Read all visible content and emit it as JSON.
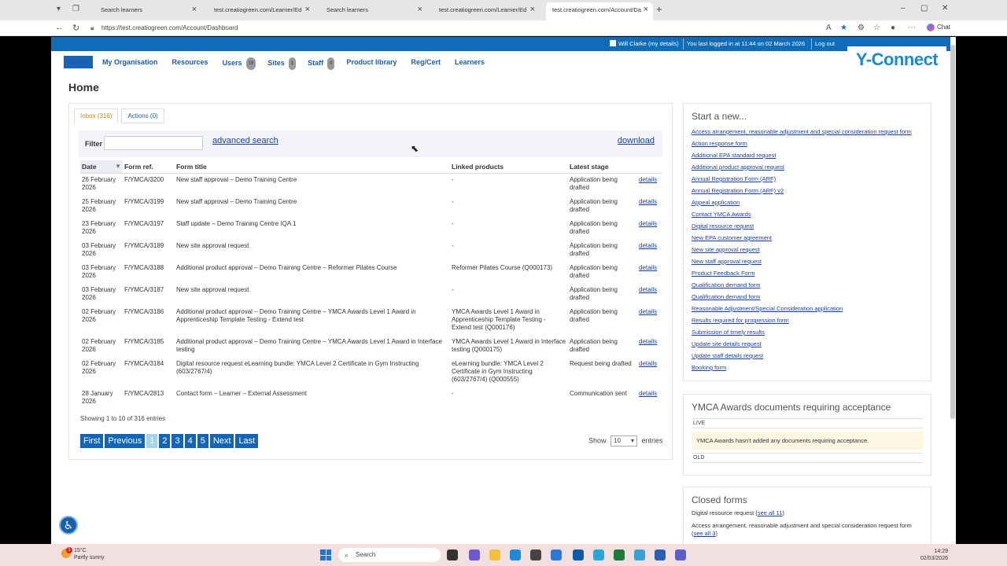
{
  "browser": {
    "tabs": [
      {
        "label": "Search learners"
      },
      {
        "label": "test.creatiogreen.com/Learner/Ed"
      },
      {
        "label": "Search learners"
      },
      {
        "label": "test.creatiogreen.com/Learner/Ed"
      },
      {
        "label": "test.creatiogreen.com/Account/Da"
      }
    ],
    "url": "https://test.creatiogreen.com/Account/Dashboard",
    "chat_label": "Chat"
  },
  "header": {
    "user_name": "Will Clarke",
    "my_details": "(my details)",
    "last_login": "You last logged in at 11:44 on 02 March 2026",
    "logout": "Log out",
    "logo": "Y-Connect"
  },
  "nav": {
    "items": [
      {
        "label": "Home"
      },
      {
        "label": "My Organisation"
      },
      {
        "label": "Resources"
      },
      {
        "label": "Users",
        "badge": "19"
      },
      {
        "label": "Sites",
        "badge": "1"
      },
      {
        "label": "Staff",
        "badge": "0"
      },
      {
        "label": "Product library"
      },
      {
        "label": "Reg/Cert"
      },
      {
        "label": "Learners"
      }
    ]
  },
  "page_title": "Home",
  "inbox": {
    "tab_inbox": "Inbox (316)",
    "tab_actions": "Actions (0)",
    "filter_label": "Filter",
    "filter_value": "",
    "advanced_search": "advanced search",
    "download": "download",
    "columns": [
      "Date",
      "Form ref.",
      "Form title",
      "Linked products",
      "Latest stage"
    ],
    "details_label": "details",
    "rows": [
      {
        "date": "26 February 2026",
        "ref": "F/YMCA/3200",
        "title": "New staff approval – Demo Training Centre",
        "linked": "-",
        "stage": "Application being drafted"
      },
      {
        "date": "25 February 2026",
        "ref": "F/YMCA/3199",
        "title": "New staff approval – Demo Training Centre",
        "linked": "-",
        "stage": "Application being drafted"
      },
      {
        "date": "23 February 2026",
        "ref": "F/YMCA/3197",
        "title": "Staff update – Demo Training Centre IQA 1",
        "linked": "-",
        "stage": "Application being drafted"
      },
      {
        "date": "03 February 2026",
        "ref": "F/YMCA/3189",
        "title": "New site approval request",
        "linked": "-",
        "stage": "Application being drafted"
      },
      {
        "date": "03 February 2026",
        "ref": "F/YMCA/3188",
        "title": "Additional product approval – Demo Training Centre – Reformer Pilates Course",
        "linked": "Reformer Pilates Course (Q000173)",
        "stage": "Application being drafted"
      },
      {
        "date": "03 February 2026",
        "ref": "F/YMCA/3187",
        "title": "New site approval request",
        "linked": "-",
        "stage": "Application being drafted"
      },
      {
        "date": "02 February 2026",
        "ref": "F/YMCA/3186",
        "title": "Additional product approval – Demo Training Centre – YMCA Awards Level 1 Award in Apprenticeship Template Testing - Extend test",
        "linked": "YMCA Awards Level 1 Award in Apprenticeship Template Testing - Extend test (Q000176)",
        "stage": "Application being drafted"
      },
      {
        "date": "02 February 2026",
        "ref": "F/YMCA/3185",
        "title": "Additional product approval – Demo Training Centre – YMCA Awards Level 1 Award in Interface testing",
        "linked": "YMCA Awards Level 1 Award in Interface testing (Q000175)",
        "stage": "Application being drafted"
      },
      {
        "date": "02 February 2026",
        "ref": "F/YMCA/3184",
        "title": "Digital resource request eLearning bundle: YMCA Level 2 Certificate in Gym Instructing (603/2767/4)",
        "linked": "eLearning bundle: YMCA Level 2 Certificate in Gym Instructing (603/2767/4) (Q000555)",
        "stage": "Request being drafted"
      },
      {
        "date": "28 January 2026",
        "ref": "F/YMCA/2813",
        "title": "Contact form – Learner – External Assessment",
        "linked": "-",
        "stage": "Communication sent"
      }
    ],
    "showing": "Showing 1 to 10 of 316 entries",
    "pager": [
      "First",
      "Previous",
      "1",
      "2",
      "3",
      "4",
      "5",
      "Next",
      "Last"
    ],
    "current_page": "1",
    "show_label": "Show",
    "show_value": "10",
    "entries_label": "entries"
  },
  "start_new": {
    "title": "Start a new...",
    "links": [
      "Access arrangement, reasonable adjustment and special consideration request form",
      "Action response form",
      "Additional EPA standard request",
      "Additional product approval request",
      "Annual Registration Form (ARF)",
      "Annual Registration Form (ARF) v2",
      "Appeal application",
      "Contact YMCA Awards",
      "Digital resource request",
      "New EPA customer agreement",
      "New site approval request",
      "New staff approval request",
      "Product Feedback Form",
      "Qualification demand form",
      "Qualification demand form",
      "Reasonable Adjustment/Special Consideration application",
      "Results required for progression form",
      "Submission of timely results",
      "Update site details request",
      "Update staff details request",
      "Booking form"
    ]
  },
  "documents": {
    "title": "YMCA Awards documents requiring acceptance",
    "live_label": "LIVE",
    "notice": "YMCA Awards hasn't added any documents requiring acceptance.",
    "old_label": "OLD"
  },
  "closed_forms": {
    "title": "Closed forms",
    "items": [
      {
        "label": "Digital resource request",
        "link": "see all 11"
      },
      {
        "label": "Access arrangement, reasonable adjustment and special consideration request form",
        "link": "see all 3"
      }
    ]
  },
  "taskbar": {
    "temp": "15°C",
    "weather": "Partly sunny",
    "search": "Search",
    "time": "14:29",
    "date": "02/03/2026",
    "weather_badge": "1"
  },
  "colors": {
    "accent": "#1565b6",
    "strip": "#0f6cb8",
    "link": "#1a3f9e",
    "active_tab": "#d4890c"
  }
}
